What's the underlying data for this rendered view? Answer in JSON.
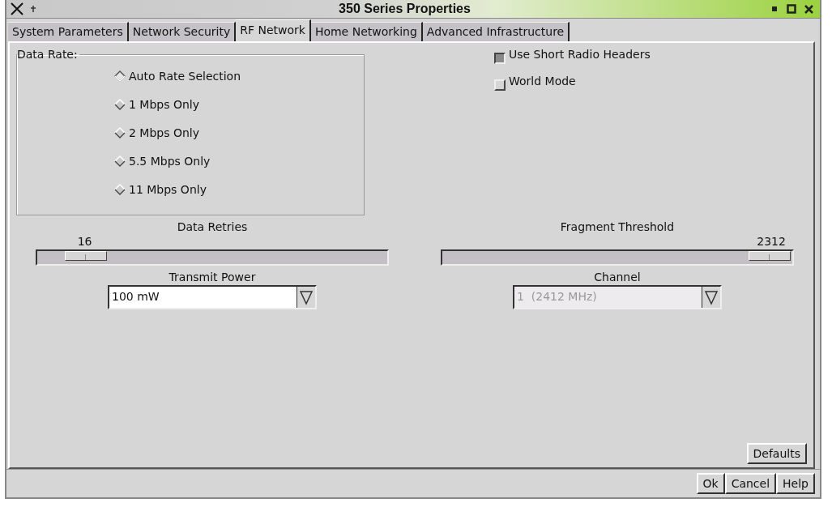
{
  "window": {
    "title": "350 Series Properties"
  },
  "tabs": [
    {
      "label": "System Parameters",
      "selected": false
    },
    {
      "label": "Network Security",
      "selected": false
    },
    {
      "label": "RF Network",
      "selected": true
    },
    {
      "label": "Home Networking",
      "selected": false
    },
    {
      "label": "Advanced Infrastructure",
      "selected": false
    }
  ],
  "data_rate": {
    "title": "Data Rate:",
    "options": [
      {
        "label": "Auto Rate Selection",
        "selected": true
      },
      {
        "label": "1 Mbps Only",
        "selected": false
      },
      {
        "label": "2 Mbps Only",
        "selected": false
      },
      {
        "label": "5.5 Mbps Only",
        "selected": false
      },
      {
        "label": "11 Mbps Only",
        "selected": false
      }
    ]
  },
  "checkboxes": [
    {
      "label": "Use Short Radio Headers",
      "checked": true
    },
    {
      "label": "World Mode",
      "checked": false
    }
  ],
  "sliders": [
    {
      "label": "Data Retries",
      "reading": "16"
    },
    {
      "label": "Fragment Threshold",
      "reading": "2312"
    }
  ],
  "dropdowns": [
    {
      "label": "Transmit Power",
      "value": "100 mW",
      "disabled": false
    },
    {
      "label": "Channel",
      "value": "1  (2412 MHz)",
      "disabled": true
    }
  ],
  "defaults_button": "Defaults",
  "buttons": [
    "Ok",
    "Cancel",
    "Help"
  ]
}
